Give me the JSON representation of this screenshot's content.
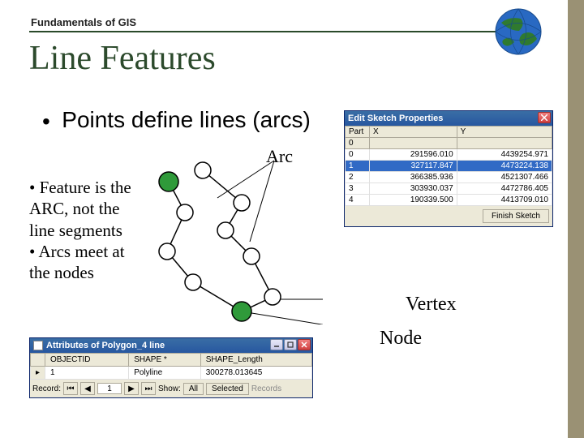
{
  "header": {
    "subtitle": "Fundamentals of GIS",
    "title": "Line Features"
  },
  "bullet_main": "Points define lines (arcs)",
  "arc_label": "Arc",
  "body_text": "• Feature is the ARC, not the line segments\n• Arcs meet at the nodes",
  "vertex_label": "Vertex",
  "node_label": "Node",
  "sketch_window": {
    "title": "Edit Sketch Properties",
    "columns": [
      "Part",
      "X",
      "Y"
    ],
    "part_header": "0",
    "rows": [
      {
        "idx": "0",
        "x": "291596.010",
        "y": "4439254.971"
      },
      {
        "idx": "1",
        "x": "327117.847",
        "y": "4473224.138"
      },
      {
        "idx": "2",
        "x": "366385.936",
        "y": "4521307.466"
      },
      {
        "idx": "3",
        "x": "303930.037",
        "y": "4472786.405"
      },
      {
        "idx": "4",
        "x": "190339.500",
        "y": "4413709.010"
      }
    ],
    "highlight_row": 1,
    "finish_button": "Finish Sketch"
  },
  "attr_window": {
    "title": "Attributes of Polygon_4 line",
    "columns": [
      "OBJECTID",
      "SHAPE *",
      "SHAPE_Length"
    ],
    "row": {
      "objectid": "1",
      "shape": "Polyline",
      "length": "300278.013645"
    },
    "footer": {
      "record_label": "Record:",
      "current": "1",
      "show_label": "Show:",
      "btn_all": "All",
      "btn_selected": "Selected",
      "records_hint": "Records"
    }
  }
}
